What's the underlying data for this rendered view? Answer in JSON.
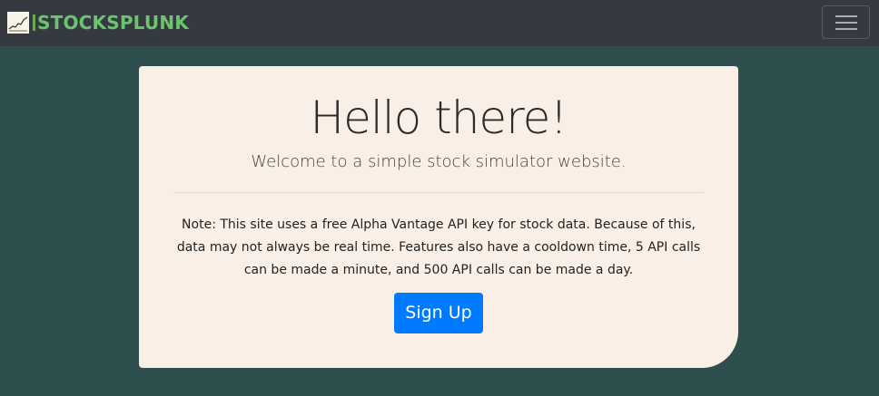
{
  "navbar": {
    "brand_text": "STOCKSPLUNK",
    "brand_logo_icon": "stock-chart-logo-icon",
    "menu_icon": "hamburger-menu-icon",
    "colors": {
      "background": "#343a40",
      "brand": "#6ec46e"
    }
  },
  "page": {
    "background": "#2f4f4f"
  },
  "jumbotron": {
    "heading": "Hello there!",
    "subheading": "Welcome to a simple stock simulator website.",
    "note": "Note: This site uses a free Alpha Vantage API key for stock data. Because of this, data may not always be real time. Features also have a cooldown time, 5 API calls can be made a minute, and 500 API calls can be made a day.",
    "signup_label": "Sign Up",
    "colors": {
      "background": "#f9efe6",
      "button": "#007bff"
    }
  }
}
